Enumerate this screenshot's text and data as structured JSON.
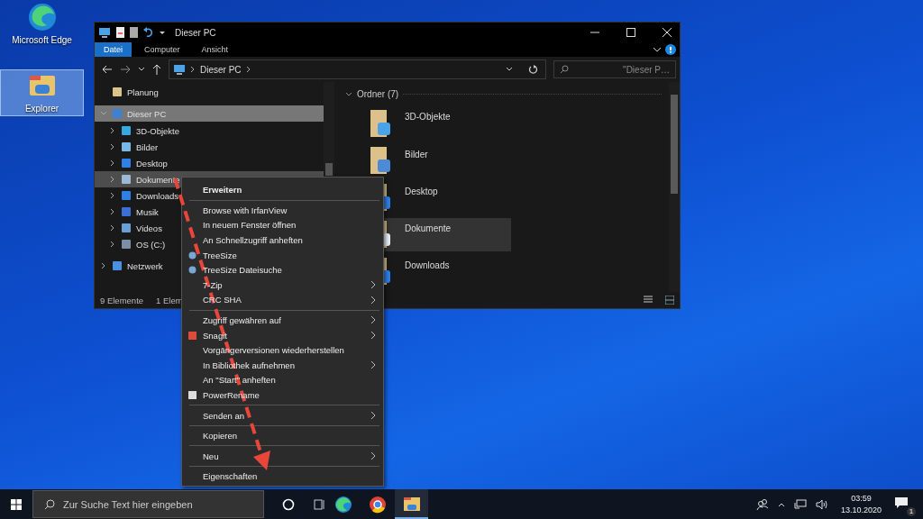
{
  "desktop_icons": [
    {
      "label": "Microsoft Edge",
      "selected": false
    },
    {
      "label": "Explorer",
      "selected": true
    }
  ],
  "window": {
    "title": "Dieser PC",
    "ribbon_tabs": [
      {
        "label": "Datei",
        "selected": true
      },
      {
        "label": "Computer",
        "selected": false
      },
      {
        "label": "Ansicht",
        "selected": false
      }
    ],
    "address": {
      "path": "Dieser PC",
      "search_placeholder": "\"Dieser P…"
    },
    "nav_tree": [
      {
        "label": "Planung",
        "selected": false,
        "hovered": false
      },
      {
        "label": "Dieser PC",
        "expanded": true,
        "selected": true,
        "hovered": false,
        "children": [
          {
            "label": "3D-Objekte",
            "expanded": false,
            "selected": false,
            "hovered": false
          },
          {
            "label": "Bilder",
            "expanded": false,
            "selected": false,
            "hovered": false
          },
          {
            "label": "Desktop",
            "expanded": false,
            "selected": false,
            "hovered": false
          },
          {
            "label": "Dokumente",
            "expanded": false,
            "selected": false,
            "hovered": true
          },
          {
            "label": "Downloads",
            "expanded": false,
            "selected": false,
            "hovered": false
          },
          {
            "label": "Musik",
            "expanded": false,
            "selected": false,
            "hovered": false
          },
          {
            "label": "Videos",
            "expanded": false,
            "selected": false,
            "hovered": false
          },
          {
            "label": "OS (C:)",
            "expanded": false,
            "selected": false,
            "hovered": false
          }
        ]
      },
      {
        "label": "Netzwerk",
        "expanded": false,
        "selected": false,
        "hovered": false
      }
    ],
    "group_header": "Ordner (7)",
    "folders": [
      {
        "label": "3D-Objekte",
        "selected": false
      },
      {
        "label": "Bilder",
        "selected": false
      },
      {
        "label": "Desktop",
        "selected": false
      },
      {
        "label": "Dokumente",
        "selected": true
      },
      {
        "label": "Downloads",
        "selected": false
      }
    ],
    "status_bar": [
      "9 Elemente",
      "1 Elem"
    ]
  },
  "context_menu": [
    {
      "kind": "header",
      "label": "Erweitern"
    },
    {
      "kind": "separator"
    },
    {
      "kind": "item",
      "label": "Browse with IrfanView"
    },
    {
      "kind": "item",
      "label": "In neuem Fenster öffnen"
    },
    {
      "kind": "item",
      "label": "An Schnellzugriff anheften"
    },
    {
      "kind": "icon_item",
      "label": "TreeSize"
    },
    {
      "kind": "icon_item",
      "label": "TreeSize Dateisuche"
    },
    {
      "kind": "item",
      "label": "7-Zip",
      "submenu": true
    },
    {
      "kind": "item",
      "label": "CRC SHA",
      "submenu": true
    },
    {
      "kind": "separator"
    },
    {
      "kind": "item",
      "label": "Zugriff gewähren auf",
      "submenu": true
    },
    {
      "kind": "icon_item",
      "label": "Snagit",
      "submenu": true
    },
    {
      "kind": "item",
      "label": "Vorgängerversionen wiederherstellen"
    },
    {
      "kind": "item",
      "label": "In Bibliothek aufnehmen",
      "submenu": true
    },
    {
      "kind": "item",
      "label": "An \"Start\" anheften"
    },
    {
      "kind": "icon_item",
      "label": "PowerRename"
    },
    {
      "kind": "separator"
    },
    {
      "kind": "item",
      "label": "Senden an",
      "submenu": true
    },
    {
      "kind": "separator"
    },
    {
      "kind": "item",
      "label": "Kopieren"
    },
    {
      "kind": "separator"
    },
    {
      "kind": "item",
      "label": "Neu",
      "submenu": true
    },
    {
      "kind": "separator"
    },
    {
      "kind": "item",
      "label": "Eigenschaften"
    }
  ],
  "taskbar": {
    "search_placeholder": "Zur Suche Text hier eingeben",
    "apps": [
      {
        "selected": false
      },
      {
        "selected": false
      },
      {
        "selected": true
      }
    ],
    "time": "03:59",
    "date": "13.10.2020",
    "notifications": "1"
  }
}
